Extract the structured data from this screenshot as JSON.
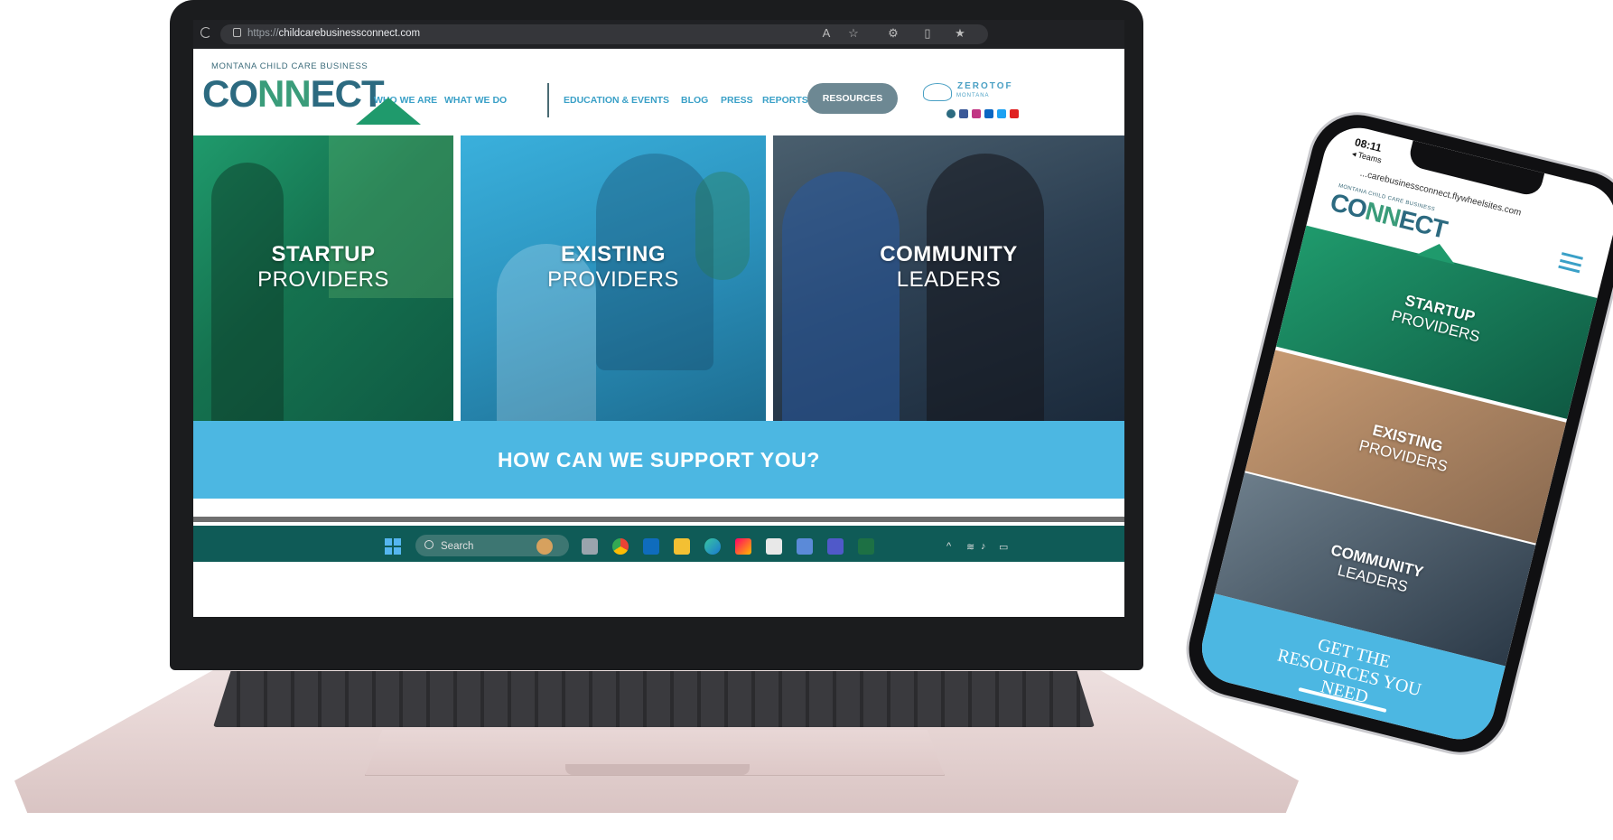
{
  "browser": {
    "url_prefix": "https://",
    "url_domain": "childcarebusinessconnect.com"
  },
  "site": {
    "logo_subtitle": "MONTANA CHILD CARE BUSINESS",
    "logo_co": "CO",
    "logo_nn": "NN",
    "logo_ect": "ECT",
    "nav": {
      "who_we_are": "WHO WE ARE",
      "what_we_do": "WHAT WE DO",
      "education_events": "EDUCATION & EVENTS",
      "blog": "BLOG",
      "press": "PRESS",
      "reports": "REPORTS",
      "resources": "RESOURCES"
    },
    "partner_logo": "ZEROTOF",
    "partner_sub": "MONTANA"
  },
  "panels": [
    {
      "line1": "STARTUP",
      "line2": "PROVIDERS"
    },
    {
      "line1": "EXISTING",
      "line2": "PROVIDERS"
    },
    {
      "line1": "COMMUNITY",
      "line2": "LEADERS"
    }
  ],
  "support_heading": "HOW CAN WE SUPPORT YOU?",
  "taskbar": {
    "search_label": "Search"
  },
  "phone": {
    "time": "08:11",
    "back_label": "◂ Teams",
    "url": "...carebusinessconnect.flywheelsites.com",
    "logo_subtitle": "MONTANA CHILD CARE BUSINESS",
    "logo_co": "CO",
    "logo_nn": "NN",
    "logo_ect": "ECT",
    "cta_line1": "GET THE",
    "cta_line2": "RESOURCES YOU",
    "cta_line3": "NEED"
  },
  "colors": {
    "brand_blue": "#4cb7e2",
    "brand_teal": "#2c6a80",
    "brand_green": "#1f9a6c",
    "resources_button": "#6d8893",
    "taskbar": "#0f5b57"
  }
}
